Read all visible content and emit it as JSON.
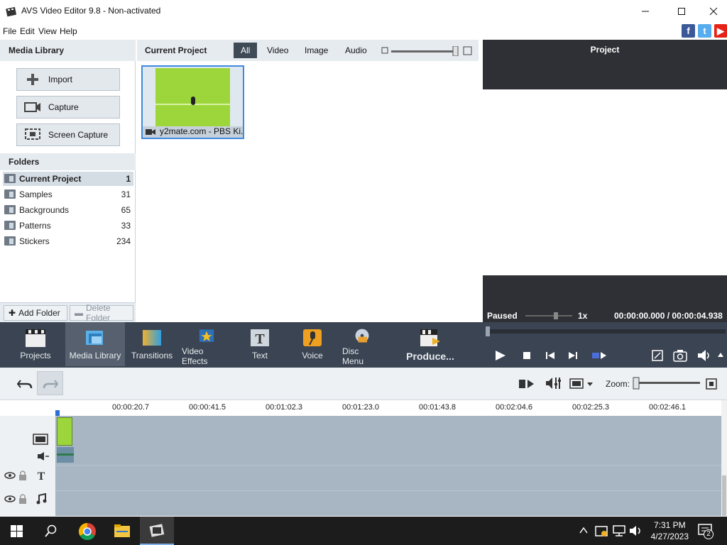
{
  "window": {
    "title": "AVS Video Editor 9.8 - Non-activated"
  },
  "menu": [
    "File",
    "Edit",
    "View",
    "Help"
  ],
  "media_library": {
    "title": "Media Library",
    "buttons": [
      "Import",
      "Capture",
      "Screen Capture"
    ],
    "folders_title": "Folders",
    "folders": [
      {
        "name": "Current Project",
        "count": "1"
      },
      {
        "name": "Samples",
        "count": "31"
      },
      {
        "name": "Backgrounds",
        "count": "65"
      },
      {
        "name": "Patterns",
        "count": "33"
      },
      {
        "name": "Stickers",
        "count": "234"
      }
    ],
    "add_folder": "Add Folder",
    "delete_folder": "Delete Folder"
  },
  "project": {
    "title": "Current Project",
    "filters": [
      "All",
      "Video",
      "Image",
      "Audio"
    ],
    "active_filter": "All",
    "clip_name": "y2mate.com - PBS Ki..."
  },
  "preview": {
    "title": "Project",
    "state": "Paused",
    "speed": "1x",
    "time": "00:00:00.000 / 00:00:04.938"
  },
  "toolbar": {
    "items": [
      "Projects",
      "Media Library",
      "Transitions",
      "Video Effects",
      "Text",
      "Voice",
      "Disc Menu",
      "Produce..."
    ],
    "active": "Media Library"
  },
  "timeline": {
    "zoom_label": "Zoom:",
    "ticks": [
      "00:00:20.7",
      "00:00:41.5",
      "00:01:02.3",
      "00:01:23.0",
      "00:01:43.8",
      "00:02:04.6",
      "00:02:25.3",
      "00:02:46.1"
    ]
  },
  "taskbar": {
    "time": "7:31 PM",
    "date": "4/27/2023",
    "notifications": "2"
  },
  "colors": {
    "toolbar_bg": "#3b4452",
    "timeline_track": "#a8b5c2",
    "clip_green": "#9dd63a",
    "accent": "#3d8be0"
  }
}
